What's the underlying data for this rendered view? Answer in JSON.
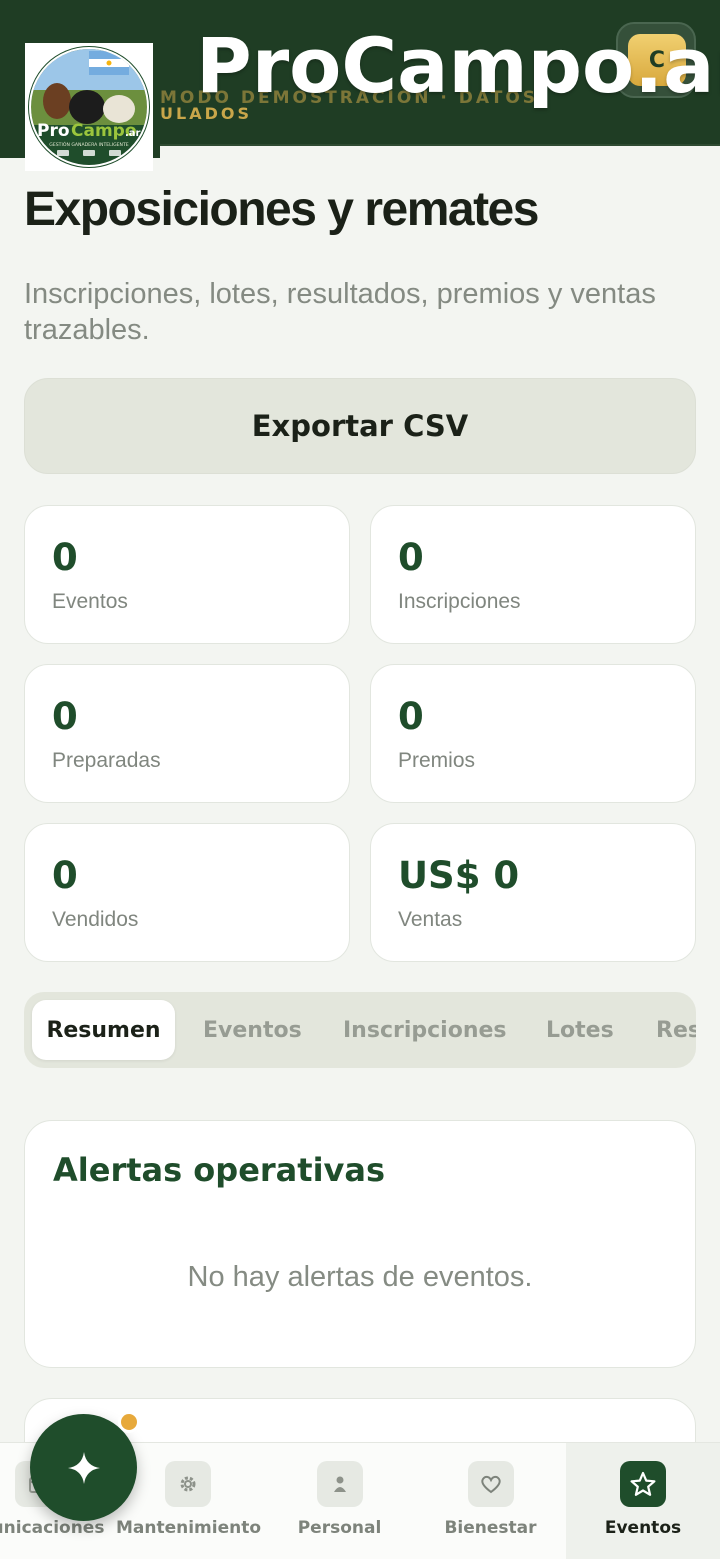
{
  "header": {
    "brand_title": "ProCampo.ar",
    "subtitle_faded": "MODO DEMOSTRACIÓN · DATOS",
    "subtitle": "ULADOS",
    "avatar_initial": "C",
    "logo_text_pro": "Pro",
    "logo_text_campo": "Campo",
    "logo_text_tld": ".ar",
    "logo_tagline": "GESTIÓN GANADERA INTELIGENTE"
  },
  "page": {
    "title": "Exposiciones y remates",
    "subtitle": "Inscripciones, lotes, resultados, premios y ventas trazables.",
    "export_label": "Exportar CSV"
  },
  "stats": [
    {
      "value": "0",
      "label": "Eventos"
    },
    {
      "value": "0",
      "label": "Inscripciones"
    },
    {
      "value": "0",
      "label": "Preparadas"
    },
    {
      "value": "0",
      "label": "Premios"
    },
    {
      "value": "0",
      "label": "Vendidos"
    },
    {
      "value": "US$ 0",
      "label": "Ventas"
    }
  ],
  "tabs": [
    {
      "label": "Resumen",
      "active": true
    },
    {
      "label": "Eventos",
      "active": false
    },
    {
      "label": "Inscripciones",
      "active": false
    },
    {
      "label": "Lotes",
      "active": false
    },
    {
      "label": "Res",
      "active": false
    }
  ],
  "alerts": {
    "title": "Alertas operativas",
    "empty": "No hay alertas de eventos."
  },
  "nav": [
    {
      "label": "unicaciones",
      "icon": "calendar-icon"
    },
    {
      "label": "Mantenimiento",
      "icon": "gear-icon"
    },
    {
      "label": "Personal",
      "icon": "person-icon"
    },
    {
      "label": "Bienestar",
      "icon": "heart-icon"
    },
    {
      "label": "Eventos",
      "icon": "star-icon",
      "active": true
    }
  ],
  "fab": {
    "icon": "sparkle-icon"
  },
  "colors": {
    "primary": "#1f4d2b",
    "header_bg": "#1f3d24",
    "accent_gold": "#c9a64a",
    "notification_dot": "#e7a93b",
    "background": "#f3f5f1"
  }
}
